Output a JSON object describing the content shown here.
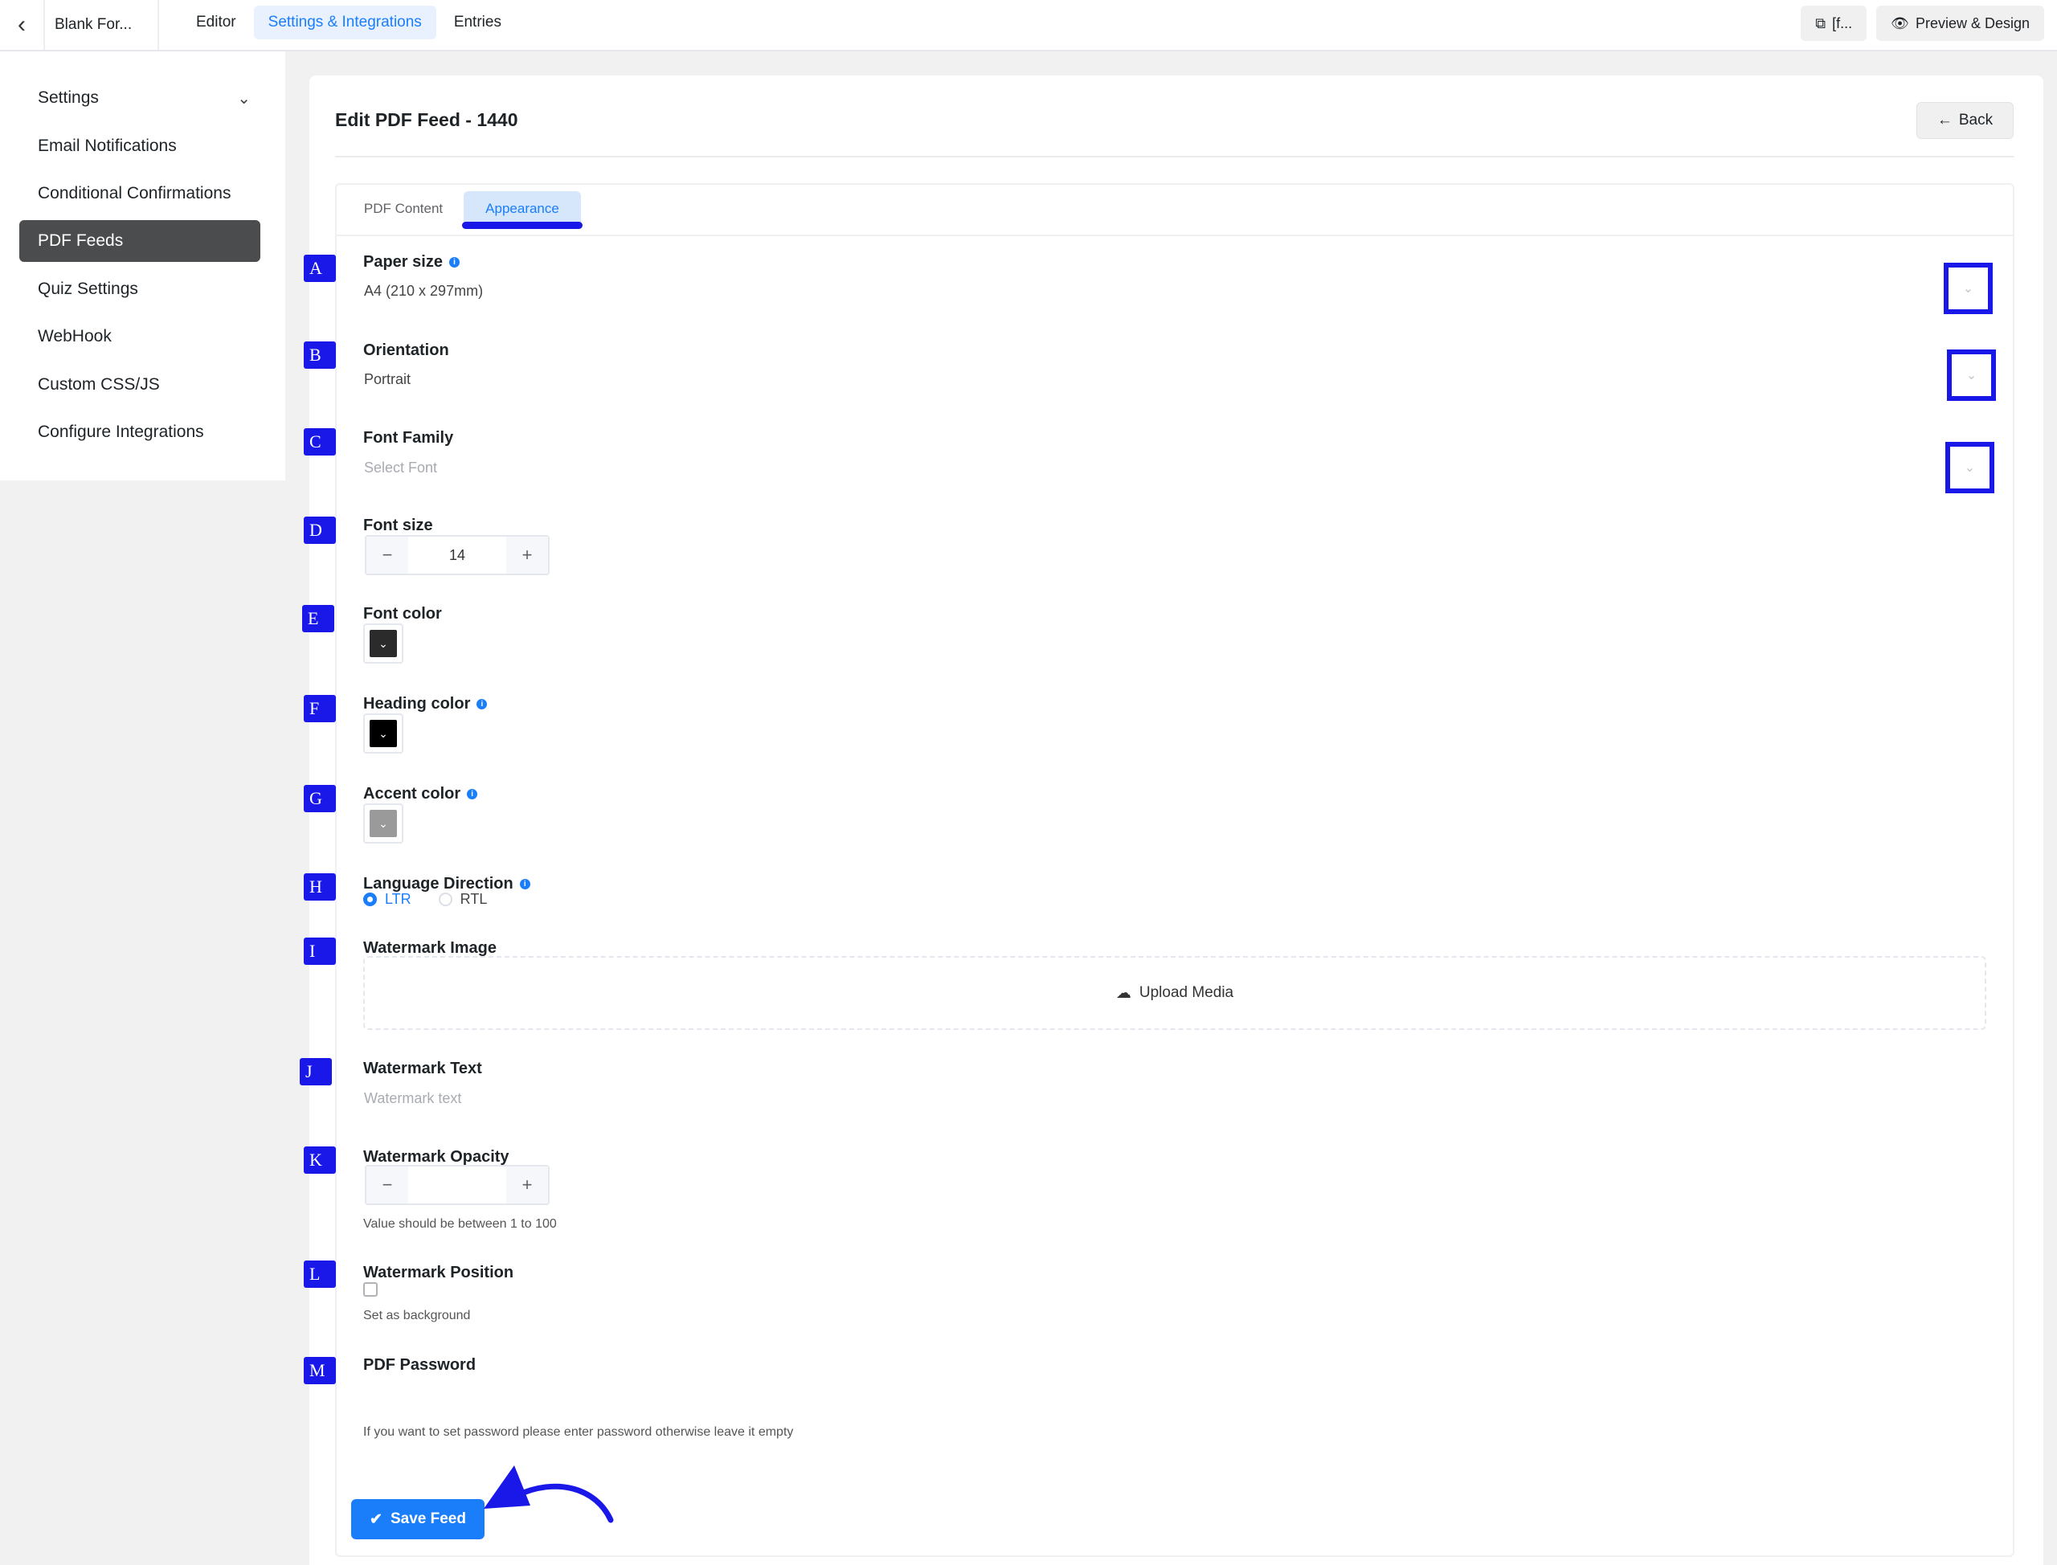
{
  "topbar": {
    "back_icon": "chevron-left-icon",
    "form_name": "Blank For...",
    "nav": [
      "Editor",
      "Settings & Integrations",
      "Entries"
    ],
    "shortcode_label": "[f...",
    "preview_label": "Preview & Design",
    "accent_color": "#1a7efb"
  },
  "sidebar": {
    "items": [
      {
        "label": "Settings"
      },
      {
        "label": "Email Notifications"
      },
      {
        "label": "Conditional Confirmations"
      },
      {
        "label": "PDF Feeds"
      },
      {
        "label": "Quiz Settings"
      },
      {
        "label": "WebHook"
      },
      {
        "label": "Custom CSS/JS"
      },
      {
        "label": "Configure Integrations"
      }
    ],
    "active": "PDF Feeds",
    "active_bg": "#4b4c4d"
  },
  "page": {
    "title": "Edit PDF Feed - 1440",
    "back_label": "Back"
  },
  "tabs": {
    "pdf_content": "PDF Content",
    "appearance": "Appearance"
  },
  "markers": [
    "A",
    "B",
    "C",
    "D",
    "E",
    "F",
    "G",
    "H",
    "I",
    "J",
    "K",
    "L",
    "M"
  ],
  "marker_color": "#1a18e8",
  "fields": {
    "paper_size": {
      "label": "Paper size",
      "value": "A4 (210 x 297mm)"
    },
    "orientation": {
      "label": "Orientation",
      "value": "Portrait"
    },
    "font_family": {
      "label": "Font Family",
      "placeholder": "Select Font"
    },
    "font_size": {
      "label": "Font size",
      "value": "14"
    },
    "font_color": {
      "label": "Font color",
      "color": "#2b2b2b"
    },
    "heading_color": {
      "label": "Heading color",
      "color": "#000000"
    },
    "accent_color": {
      "label": "Accent color",
      "color": "#9a9a9a"
    },
    "language_direction": {
      "label": "Language Direction",
      "options": [
        "LTR",
        "RTL"
      ],
      "selected": "LTR"
    },
    "watermark_image": {
      "label": "Watermark Image",
      "upload_label": "Upload Media"
    },
    "watermark_text": {
      "label": "Watermark Text",
      "placeholder": "Watermark text"
    },
    "watermark_opacity": {
      "label": "Watermark Opacity",
      "value": "",
      "help": "Value should be between 1 to 100"
    },
    "watermark_position": {
      "label": "Watermark Position",
      "checkbox_label": "Set as background",
      "checked": false
    },
    "pdf_password": {
      "label": "PDF Password",
      "help": "If you want to set password please enter password otherwise leave it empty"
    }
  },
  "save_label": "Save Feed"
}
